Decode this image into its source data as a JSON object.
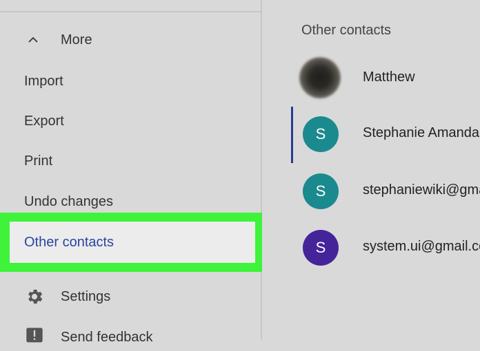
{
  "sidebar": {
    "more_label": "More",
    "items": [
      {
        "label": "Import"
      },
      {
        "label": "Export"
      },
      {
        "label": "Print"
      },
      {
        "label": "Undo changes"
      },
      {
        "label": "Other contacts"
      }
    ],
    "settings_label": "Settings",
    "feedback_label": "Send feedback"
  },
  "main": {
    "section_title": "Other contacts",
    "contacts": [
      {
        "name": "Matthew",
        "initial": "",
        "avatar_color": "#2b2a26"
      },
      {
        "name": "Stephanie Amanda",
        "initial": "S",
        "avatar_color": "#1a8a8f"
      },
      {
        "name": "stephaniewiki@gma",
        "initial": "S",
        "avatar_color": "#1a8a8f"
      },
      {
        "name": "system.ui@gmail.co",
        "initial": "S",
        "avatar_color": "#45249a"
      }
    ]
  },
  "colors": {
    "highlight": "#3ef33a",
    "selected_text": "#2a44a0",
    "selected_bar": "#2a3a8f"
  }
}
